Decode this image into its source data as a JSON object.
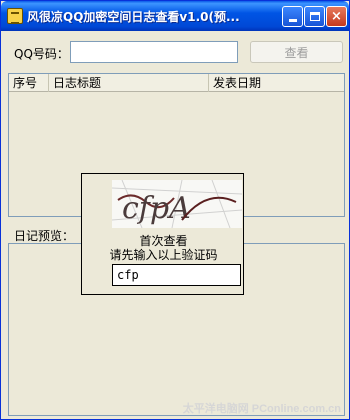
{
  "window": {
    "title": "风很凉QQ加密空间日志查看v1.0(预...",
    "min_symbol": "",
    "max_symbol": "",
    "close_symbol": "×"
  },
  "search": {
    "label": "QQ号码：",
    "value": "",
    "button": "查看"
  },
  "list": {
    "columns": [
      "序号",
      "日志标题",
      "发表日期"
    ]
  },
  "preview": {
    "label": "日记预览："
  },
  "dialog": {
    "line1": "首次查看",
    "line2": "请先输入以上验证码",
    "code_value": "cfp",
    "captcha_text": "cfpA"
  },
  "watermark": "太平洋电脑网 PConline.com.cn",
  "colors": {
    "titlebar": "#0054e3",
    "window_bg": "#ece9d8"
  }
}
